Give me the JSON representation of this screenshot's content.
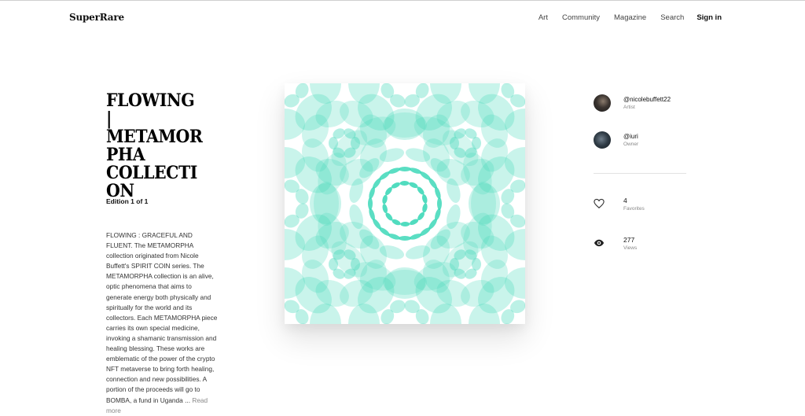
{
  "header": {
    "logo": "SuperRare",
    "nav": [
      "Art",
      "Community",
      "Magazine",
      "Search"
    ],
    "signin": "Sign in"
  },
  "artwork": {
    "title": "FLOWING |\nMETAMOR\nPHA\nCOLLECTI\nON",
    "edition": "Edition 1 of 1",
    "description": "FLOWING : GRACEFUL AND FLUENT. The METAMORPHA collection originated from Nicole Buffett's SPIRIT COIN series. The METAMORPHA collection is an alive, optic phenomena that aims to generate energy both physically and spiritually for the world and its collectors. Each METAMORPHA piece carries its own special medicine, invoking a shamanic transmission and healing blessing. These works are emblematic of the power of the crypto NFT metaverse to bring forth healing, connection and new possibilities. A portion of the proceeds will go to BOMBA, a fund in Uganda",
    "read_more": "Read more",
    "accent_color": "#3ed8b8"
  },
  "artist": {
    "handle": "@nicolebuffett22",
    "role": "Artist"
  },
  "owner": {
    "handle": "@iuri",
    "role": "Owner"
  },
  "stats": {
    "favorites": {
      "value": "4",
      "label": "Favorites",
      "icon": "heart-icon"
    },
    "views": {
      "value": "277",
      "label": "Views",
      "icon": "eye-icon"
    }
  }
}
